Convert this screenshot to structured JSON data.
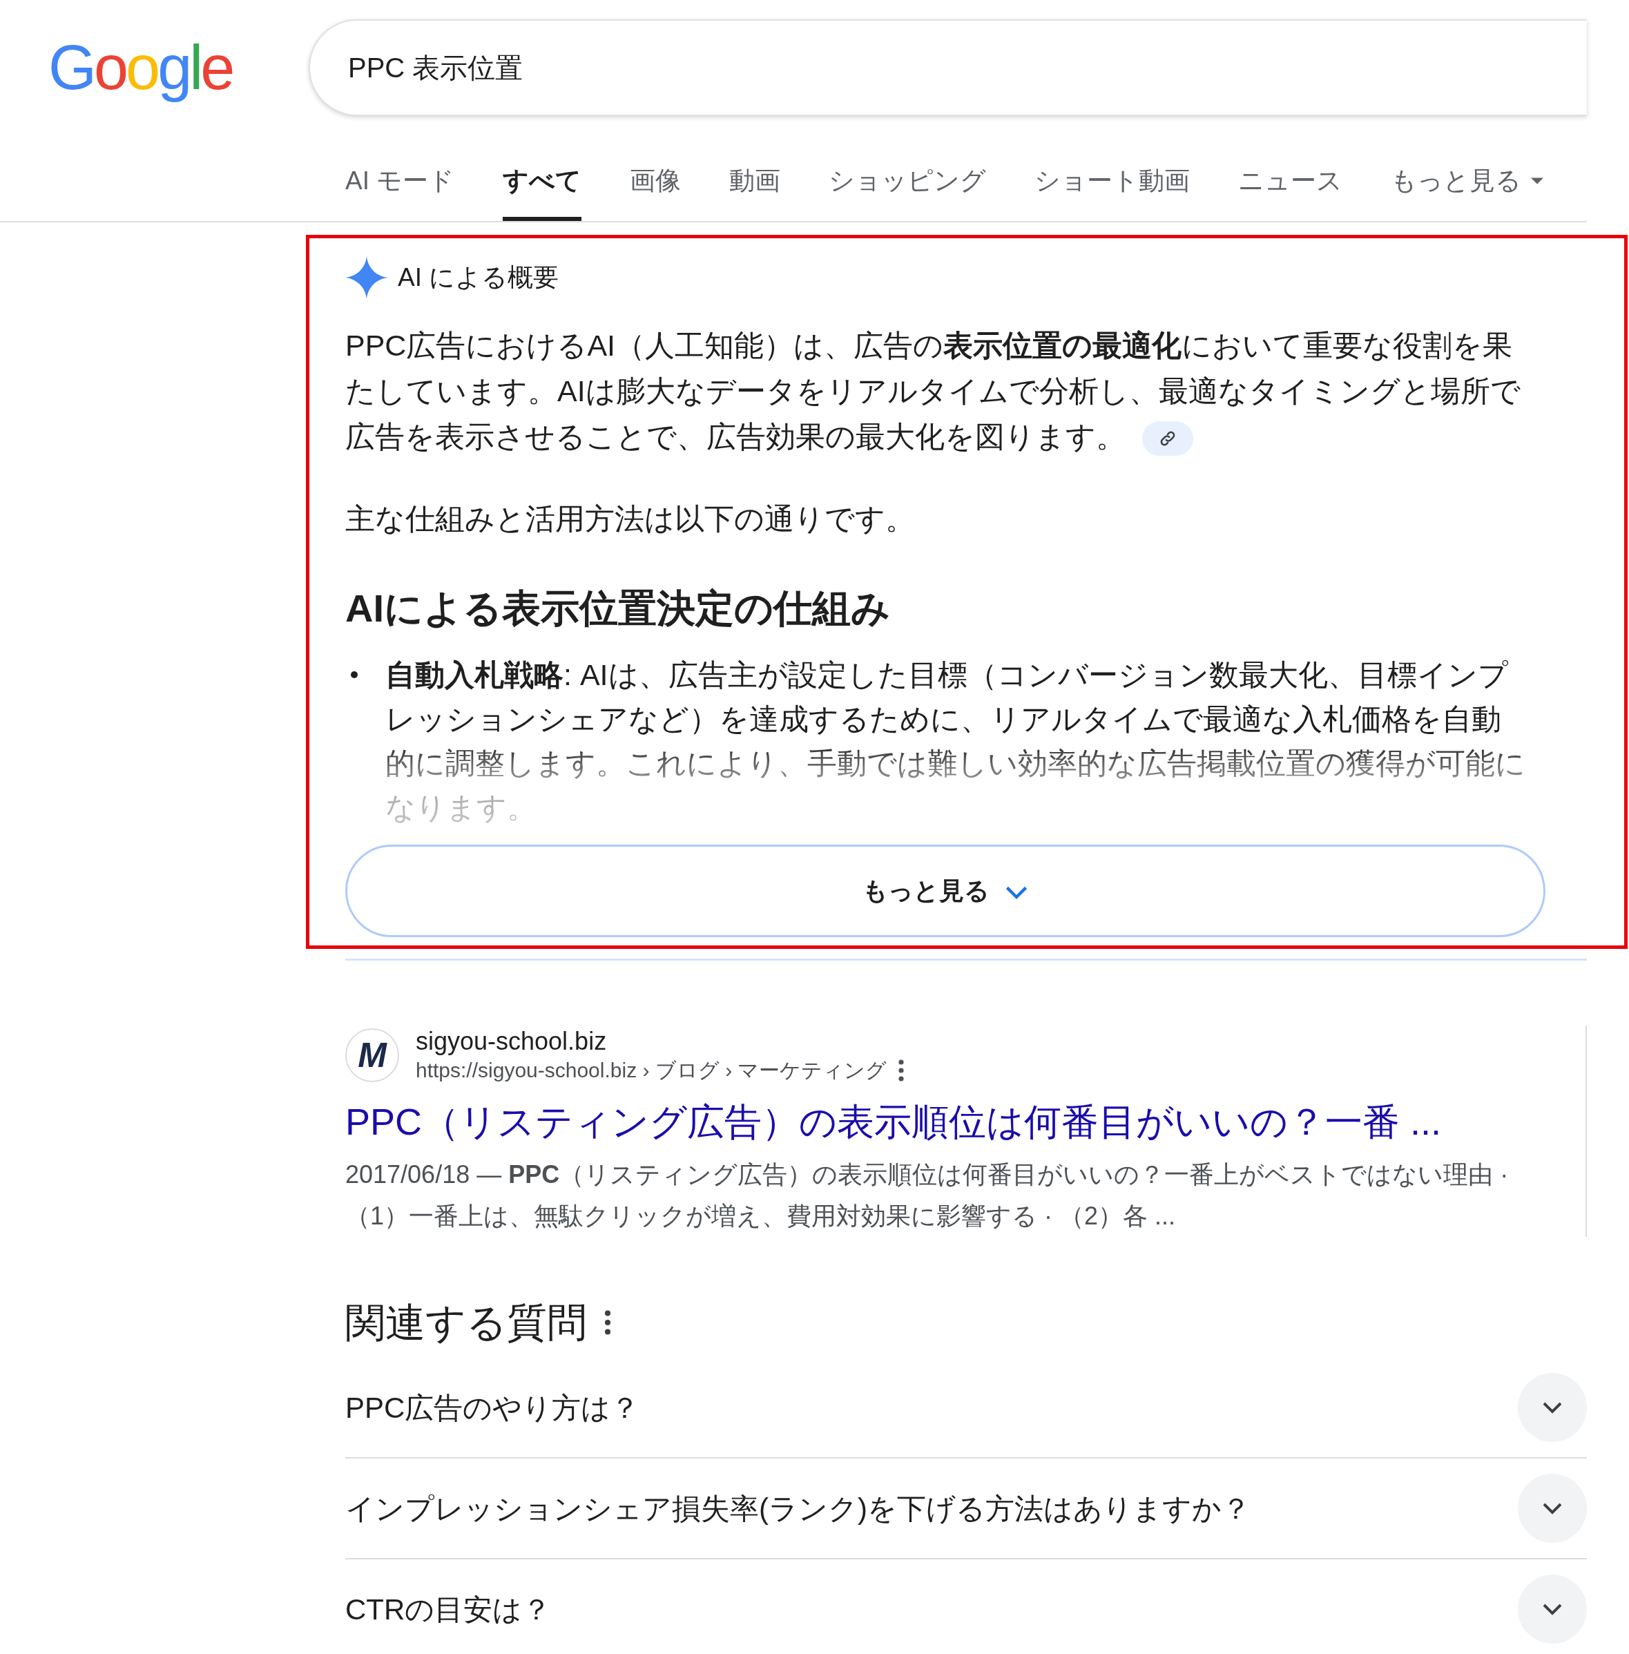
{
  "logo": "Google",
  "search": {
    "value": "PPC 表示位置"
  },
  "tabs": [
    {
      "label": "AI モード",
      "selected": false,
      "kind": "tab"
    },
    {
      "label": "すべて",
      "selected": true,
      "kind": "tab"
    },
    {
      "label": "画像",
      "selected": false,
      "kind": "tab"
    },
    {
      "label": "動画",
      "selected": false,
      "kind": "tab"
    },
    {
      "label": "ショッピング",
      "selected": false,
      "kind": "tab"
    },
    {
      "label": "ショート動画",
      "selected": false,
      "kind": "tab"
    },
    {
      "label": "ニュース",
      "selected": false,
      "kind": "tab"
    },
    {
      "label": "もっと見る",
      "selected": false,
      "kind": "dropdown"
    }
  ],
  "ai_overview": {
    "title": "AI による概要",
    "paragraph": "PPC広告におけるAI（人工知能）は、広告の**表示位置の最適化**において重要な役割を果たしています。AIは膨大なデータをリアルタイムで分析し、最適なタイミングと場所で広告を表示させることで、広告効果の最大化を図ります。",
    "intro": "主な仕組みと活用方法は以下の通りです。",
    "heading": "AIによる表示位置決定の仕組み",
    "bullets": [
      "**自動入札戦略**: AIは、広告主が設定した目標（コンバージョン数最大化、目標インプレッションシェアなど）を達成するために、リアルタイムで最適な入札価格を自動的に調整します。これにより、手動では難しい効率的な広告掲載位置の獲得が可能になります。"
    ],
    "more_button": "もっと見る"
  },
  "result": {
    "favicon": "M",
    "site": "sigyou-school.biz",
    "url": "https://sigyou-school.biz › ブログ › マーケティング",
    "title": "PPC（リスティング広告）の表示順位は何番目がいいの？一番 ...",
    "snippet": "2017/06/18 — **PPC**（リスティング広告）の表示順位は何番目がいいの？一番上がベストではない理由 · （1）一番上は、無駄クリックが増え、費用対効果に影響する · （2）各 ..."
  },
  "related": {
    "title": "関連する質問",
    "questions": [
      {
        "text": "PPC広告のやり方は？",
        "expanded": false
      },
      {
        "text": "インプレッションシェア損失率(ランク)を下げる方法はありますか？",
        "expanded": false
      },
      {
        "text": "CTRの目安は？",
        "expanded": false
      }
    ]
  }
}
